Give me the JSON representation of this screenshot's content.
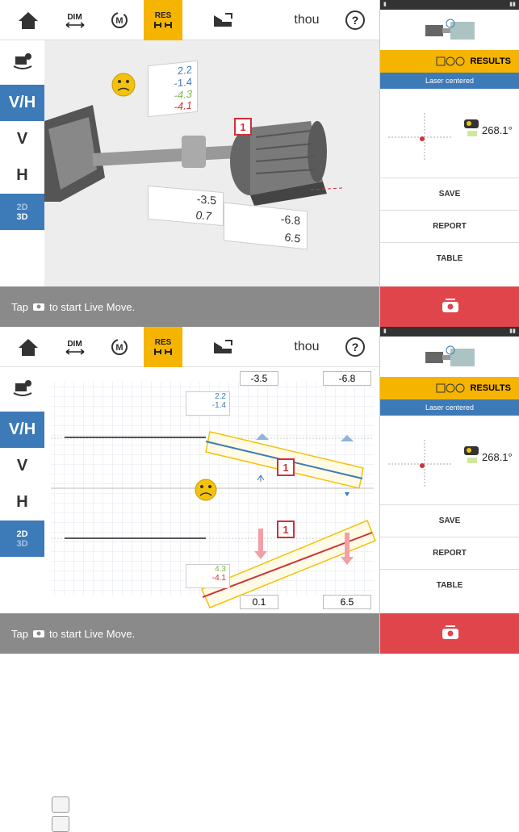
{
  "toolbar": {
    "dim_label": "DIM",
    "res_label": "RES",
    "units": "thou",
    "help": "?"
  },
  "side": {
    "vh": "V/H",
    "v": "V",
    "h": "H",
    "d2": "2D",
    "d3": "3D"
  },
  "status": {
    "prefix": "Tap",
    "suffix": "to start Live Move."
  },
  "right_panel": {
    "results": "RESULTS",
    "laser_status": "Laser centered",
    "angle": "268.1°",
    "save": "SAVE",
    "report": "REPORT",
    "table": "TABLE"
  },
  "view3d": {
    "coupling": {
      "vertical_offset": "2.2",
      "vertical_angularity": "-1.4",
      "horizontal_offset": "-4.3",
      "horizontal_angularity": "-4.1"
    },
    "machine_label": "1",
    "feet": {
      "front_vertical": "-3.5",
      "back_vertical": "-6.8",
      "front_horizontal": "0.7",
      "back_horizontal": "6.5"
    }
  },
  "chart_view": {
    "top_values": [
      "-3.5",
      "-6.8"
    ],
    "bottom_values": [
      "0.1",
      "6.5"
    ],
    "vertical": {
      "offset": "2.2",
      "angularity": "-1.4"
    },
    "horizontal": {
      "offset": "4.3",
      "angularity": "-4.1"
    },
    "machine_label": "1"
  },
  "colors": {
    "accent": "#f4b400",
    "blue": "#3d7ab8",
    "red": "#e0454b",
    "vertical_line": "#3d7ab8",
    "horizontal_line": "#d0303a"
  }
}
